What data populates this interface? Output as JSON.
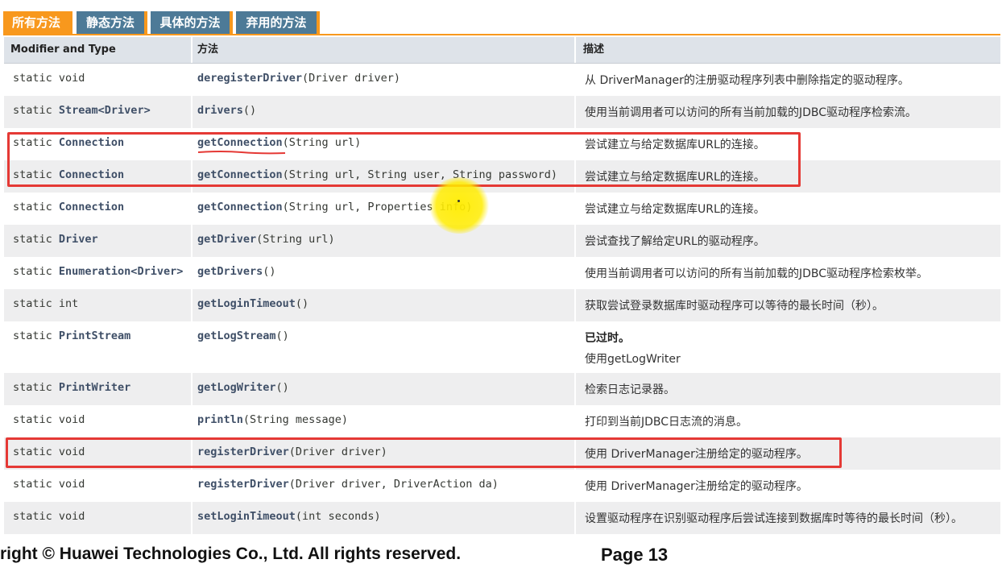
{
  "tabs": [
    {
      "label": "所有方法",
      "active": true
    },
    {
      "label": "静态方法",
      "active": false
    },
    {
      "label": "具体的方法",
      "active": false
    },
    {
      "label": "弃用的方法",
      "active": false
    }
  ],
  "headers": {
    "modifier": "Modifier and Type",
    "method": "方法",
    "desc": "描述"
  },
  "rows": [
    {
      "mod_pre": "static void",
      "mod_type": "",
      "method_name": "deregisterDriver",
      "params": "(Driver driver)",
      "desc": "从 DriverManager的注册驱动程序列表中删除指定的驱动程序。"
    },
    {
      "mod_pre": "static ",
      "mod_type": "Stream<Driver>",
      "method_name": "drivers",
      "params": "()",
      "desc": "使用当前调用者可以访问的所有当前加载的JDBC驱动程序检索流。"
    },
    {
      "mod_pre": "static ",
      "mod_type": "Connection",
      "method_name": "getConnection",
      "params": "(String url)",
      "desc": "尝试建立与给定数据库URL的连接。"
    },
    {
      "mod_pre": "static ",
      "mod_type": "Connection",
      "method_name": "getConnection",
      "params": "(String url, String user, String password)",
      "desc": "尝试建立与给定数据库URL的连接。"
    },
    {
      "mod_pre": "static ",
      "mod_type": "Connection",
      "method_name": "getConnection",
      "params": "(String url, Properties info)",
      "desc": "尝试建立与给定数据库URL的连接。"
    },
    {
      "mod_pre": "static ",
      "mod_type": "Driver",
      "method_name": "getDriver",
      "params": "(String url)",
      "desc": "尝试查找了解给定URL的驱动程序。"
    },
    {
      "mod_pre": "static ",
      "mod_type": "Enumeration<Driver>",
      "method_name": "getDrivers",
      "params": "()",
      "desc": "使用当前调用者可以访问的所有当前加载的JDBC驱动程序检索枚举。"
    },
    {
      "mod_pre": "static int",
      "mod_type": "",
      "method_name": "getLoginTimeout",
      "params": "()",
      "desc": "获取尝试登录数据库时驱动程序可以等待的最长时间（秒）。"
    },
    {
      "mod_pre": "static ",
      "mod_type": "PrintStream",
      "method_name": "getLogStream",
      "params": "()",
      "desc": "使用getLogWriter",
      "deprecated": "已过时。"
    },
    {
      "mod_pre": "static ",
      "mod_type": "PrintWriter",
      "method_name": "getLogWriter",
      "params": "()",
      "desc": "检索日志记录器。"
    },
    {
      "mod_pre": "static void",
      "mod_type": "",
      "method_name": "println",
      "params": "(String message)",
      "desc": "打印到当前JDBC日志流的消息。"
    },
    {
      "mod_pre": "static void",
      "mod_type": "",
      "method_name": "registerDriver",
      "params": "(Driver driver)",
      "desc": "使用 DriverManager注册给定的驱动程序。"
    },
    {
      "mod_pre": "static void",
      "mod_type": "",
      "method_name": "registerDriver",
      "params": "(Driver driver, DriverAction da)",
      "desc": "使用 DriverManager注册给定的驱动程序。"
    },
    {
      "mod_pre": "static void",
      "mod_type": "",
      "method_name": "setLoginTimeout",
      "params": "(int seconds)",
      "desc": "设置驱动程序在识别驱动程序后尝试连接到数据库时等待的最长时间（秒）。"
    }
  ],
  "footer": {
    "copyright": "right © Huawei Technologies Co., Ltd. All rights reserved.",
    "page": "Page 13"
  },
  "colors": {
    "tab_active": "#f8981d",
    "tab_inactive": "#4d7a97",
    "highlight": "#e53935",
    "cursor": "#ffec00"
  }
}
